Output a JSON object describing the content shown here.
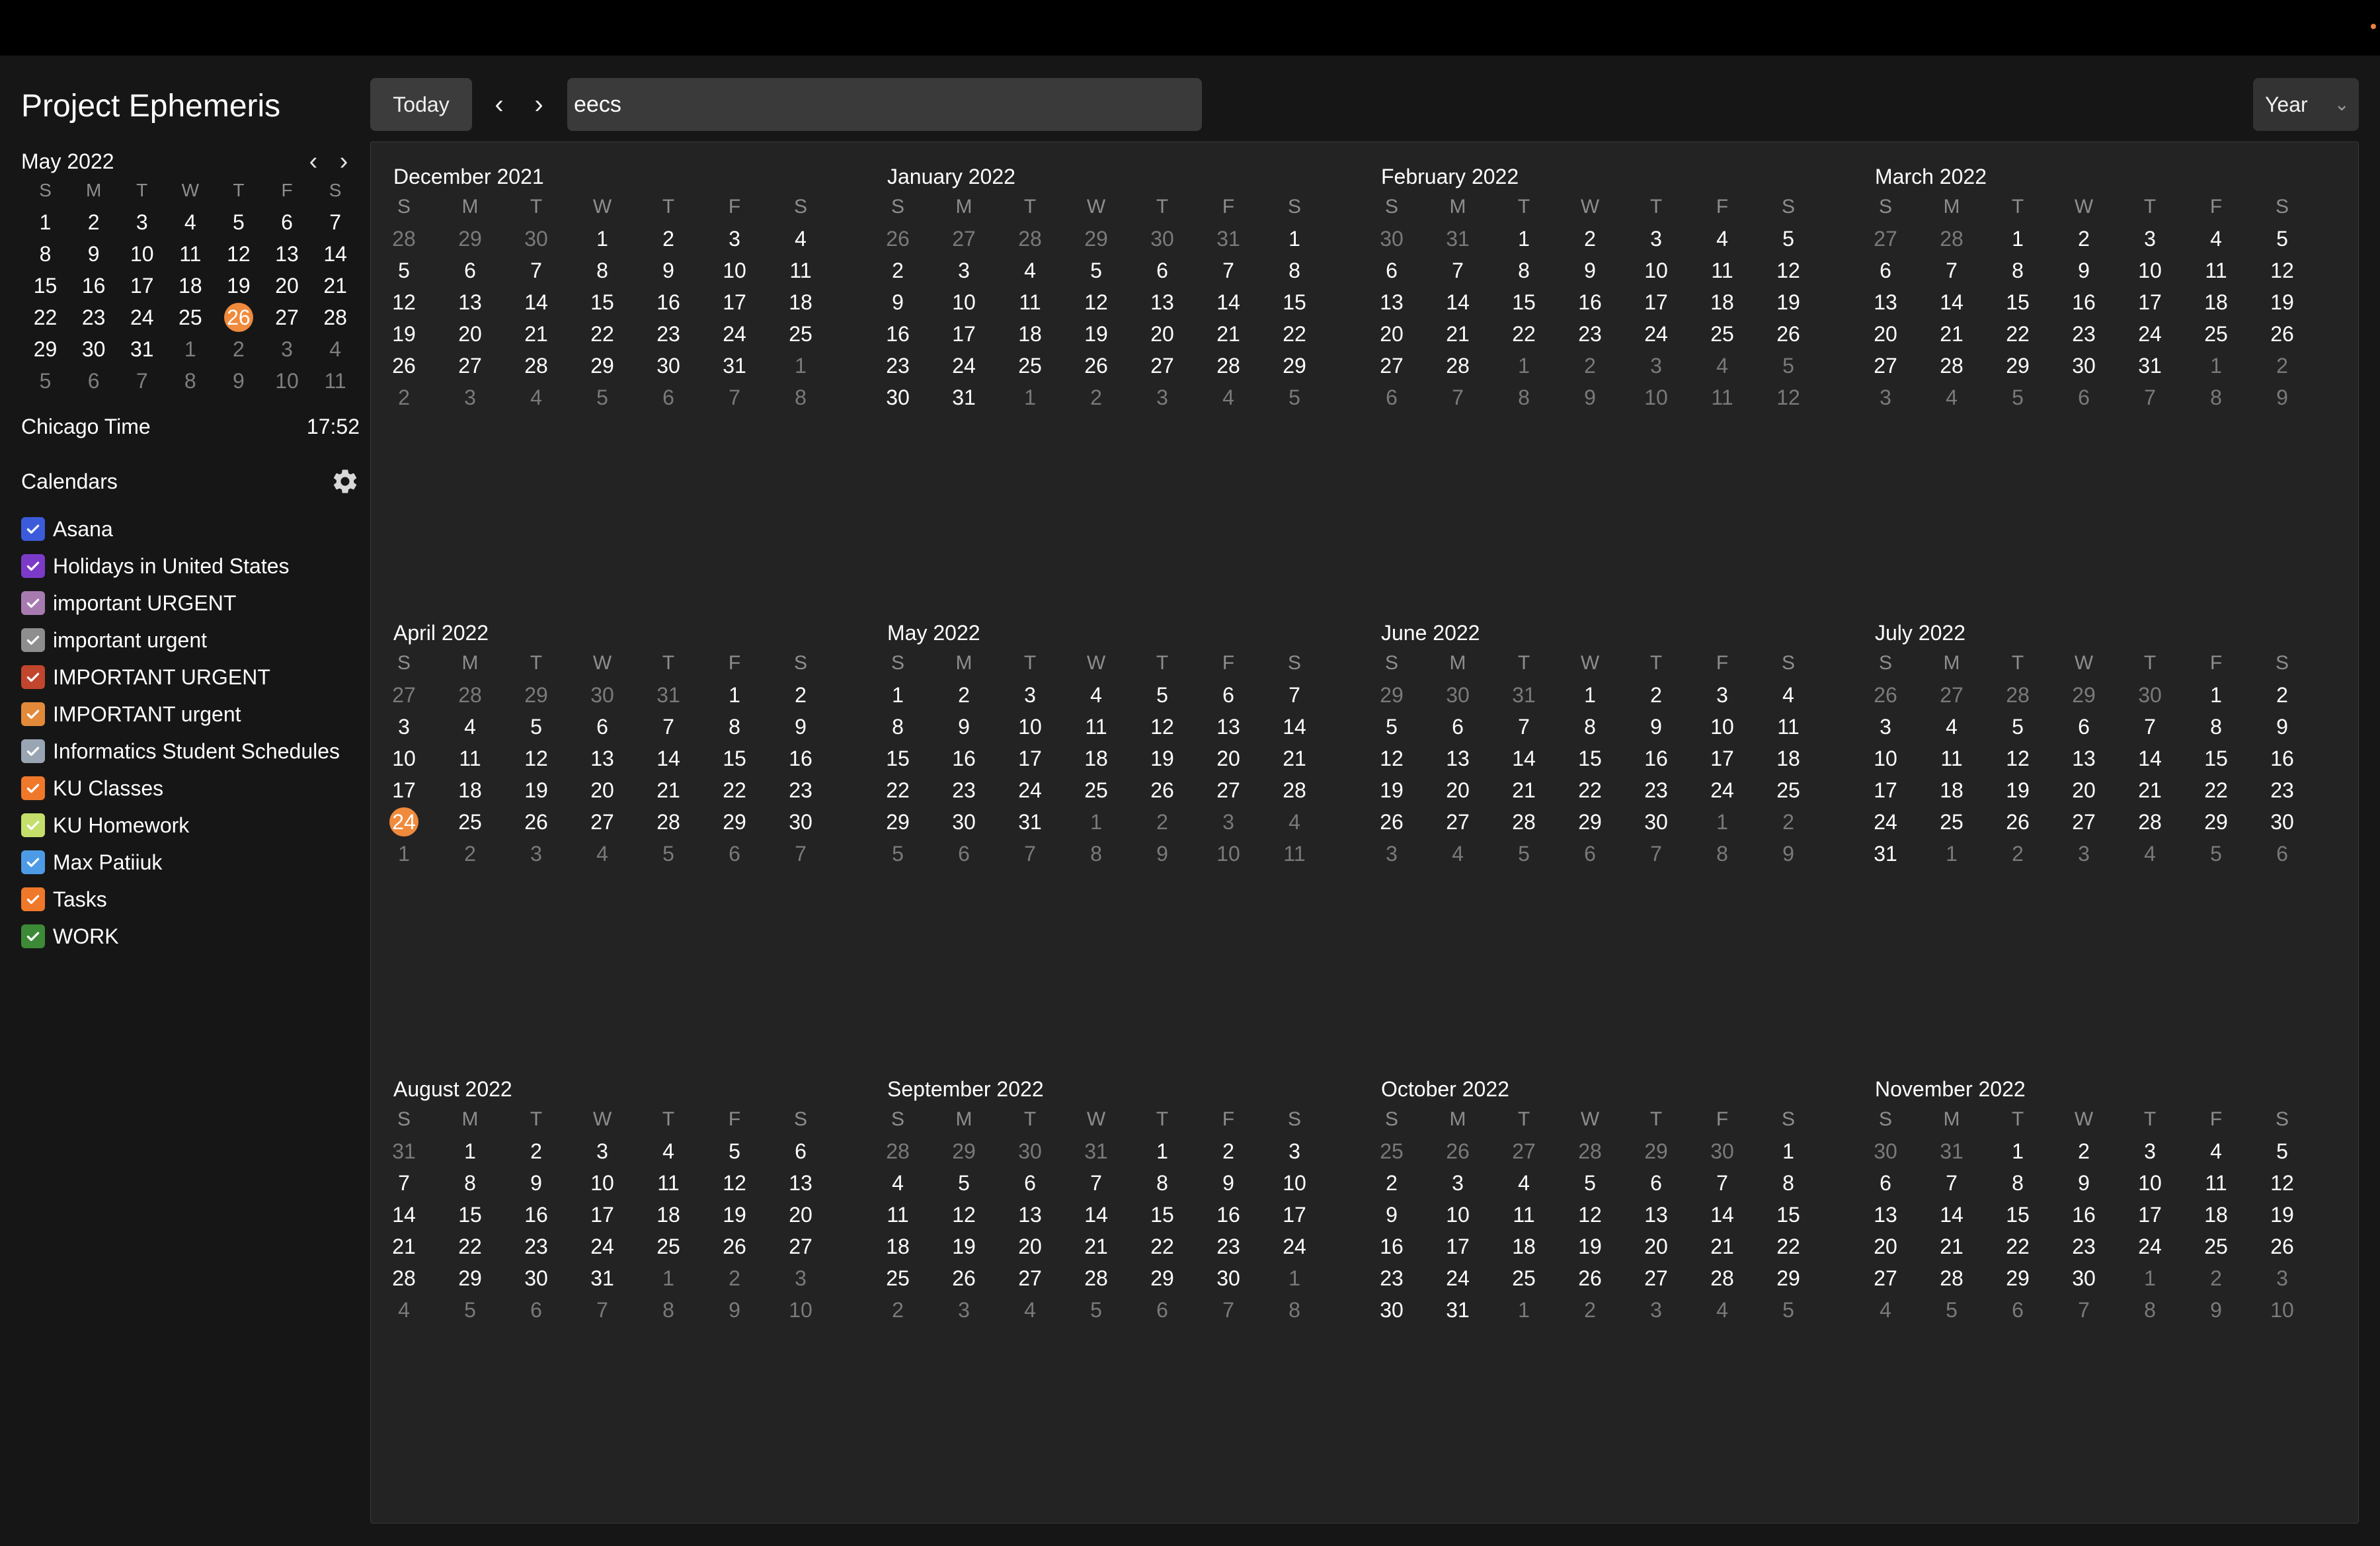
{
  "app": {
    "title": "Project Ephemeris"
  },
  "toolbar": {
    "today_label": "Today",
    "search_value": "eecs",
    "view_label": "Year"
  },
  "mini_calendar": {
    "month_label": "May 2022",
    "today_day": 26
  },
  "clock": {
    "label": "Chicago Time",
    "time": "17:52"
  },
  "calendars_section": {
    "label": "Calendars"
  },
  "calendars": [
    {
      "name": "Asana",
      "color": "#3b5bdb",
      "checked": true
    },
    {
      "name": "Holidays in United States",
      "color": "#7c3ac8",
      "checked": true
    },
    {
      "name": "important URGENT",
      "color": "#a77bb0",
      "checked": true
    },
    {
      "name": "important urgent",
      "color": "#8e8e8e",
      "checked": true
    },
    {
      "name": "IMPORTANT URGENT",
      "color": "#c2452d",
      "checked": true
    },
    {
      "name": "IMPORTANT urgent",
      "color": "#e28a3a",
      "checked": true
    },
    {
      "name": "Informatics Student Schedules",
      "color": "#9aa5b4",
      "checked": true
    },
    {
      "name": "KU Classes",
      "color": "#f0782a",
      "checked": true
    },
    {
      "name": "KU Homework",
      "color": "#c4e06a",
      "checked": true
    },
    {
      "name": "Max Patiiuk",
      "color": "#4d9be6",
      "checked": true
    },
    {
      "name": "Tasks",
      "color": "#f0782a",
      "checked": true
    },
    {
      "name": "WORK",
      "color": "#3c8a36",
      "checked": true
    }
  ],
  "weekday_labels": [
    "S",
    "M",
    "T",
    "W",
    "T",
    "F",
    "S"
  ],
  "theme": {
    "accent": "#f08a3c"
  },
  "year_view": {
    "today": {
      "month": "April 2022",
      "day": 24
    },
    "months": [
      {
        "label": "December 2021",
        "lead": [
          28,
          29,
          30
        ],
        "days": 31,
        "trail": [
          1,
          2,
          3,
          4,
          5,
          6,
          7,
          8
        ]
      },
      {
        "label": "January 2022",
        "lead": [
          26,
          27,
          28,
          29,
          30,
          31
        ],
        "days": 31,
        "trail": [
          1,
          2,
          3,
          4,
          5
        ]
      },
      {
        "label": "February 2022",
        "lead": [
          30,
          31
        ],
        "days": 28,
        "trail": [
          1,
          2,
          3,
          4,
          5,
          6,
          7,
          8,
          9,
          10,
          11,
          12
        ]
      },
      {
        "label": "March 2022",
        "lead": [
          27,
          28
        ],
        "days": 31,
        "trail": [
          1,
          2,
          3,
          4,
          5,
          6,
          7,
          8,
          9
        ]
      },
      {
        "label": "April 2022",
        "lead": [
          27,
          28,
          29,
          30,
          31
        ],
        "days": 30,
        "trail": [
          1,
          2,
          3,
          4,
          5,
          6,
          7
        ]
      },
      {
        "label": "May 2022",
        "lead": [],
        "days": 31,
        "trail": [
          1,
          2,
          3,
          4,
          5,
          6,
          7,
          8,
          9,
          10,
          11
        ]
      },
      {
        "label": "June 2022",
        "lead": [
          29,
          30,
          31
        ],
        "days": 30,
        "trail": [
          1,
          2,
          3,
          4,
          5,
          6,
          7,
          8,
          9
        ]
      },
      {
        "label": "July 2022",
        "lead": [
          26,
          27,
          28,
          29,
          30
        ],
        "days": 31,
        "trail": [
          1,
          2,
          3,
          4,
          5,
          6
        ]
      },
      {
        "label": "August 2022",
        "lead": [
          31
        ],
        "days": 31,
        "trail": [
          1,
          2,
          3,
          4,
          5,
          6,
          7,
          8,
          9,
          10
        ]
      },
      {
        "label": "September 2022",
        "lead": [
          28,
          29,
          30,
          31
        ],
        "days": 30,
        "trail": [
          1,
          2,
          3,
          4,
          5,
          6,
          7,
          8
        ]
      },
      {
        "label": "October 2022",
        "lead": [
          25,
          26,
          27,
          28,
          29,
          30
        ],
        "days": 31,
        "trail": [
          1,
          2,
          3,
          4,
          5
        ]
      },
      {
        "label": "November 2022",
        "lead": [
          30,
          31
        ],
        "days": 30,
        "trail": [
          1,
          2,
          3,
          4,
          5,
          6,
          7,
          8,
          9,
          10
        ]
      }
    ]
  }
}
